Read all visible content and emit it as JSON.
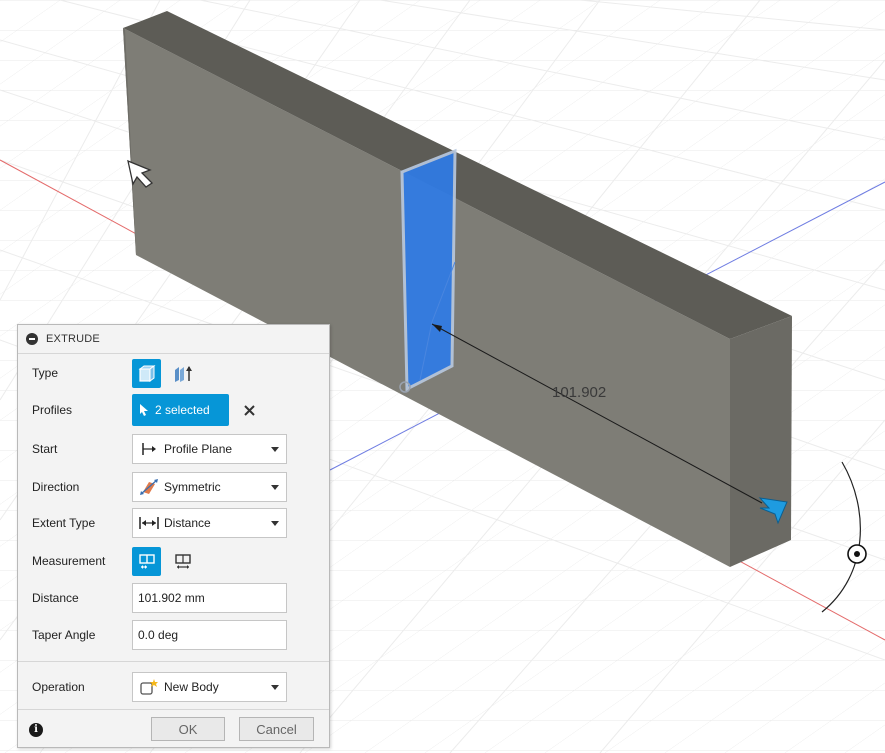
{
  "viewport": {
    "dimension_value": "101.902",
    "colors": {
      "body_front": "#7e7d76",
      "body_top": "#5d5c56",
      "body_side": "#6b6a64",
      "profile_face": "#2f7be6",
      "x_axis": "#e46b6b",
      "y_axis": "#6f7de2",
      "grid": "#e3e3e3",
      "handle": "#1e9be0"
    }
  },
  "dialog": {
    "title": "EXTRUDE",
    "type": {
      "label": "Type",
      "options": [
        {
          "name": "solid-extrude-icon",
          "selected": true
        },
        {
          "name": "thin-extrude-icon",
          "selected": false
        }
      ]
    },
    "profiles": {
      "label": "Profiles",
      "value": "2 selected"
    },
    "start": {
      "label": "Start",
      "value": "Profile Plane"
    },
    "direction": {
      "label": "Direction",
      "value": "Symmetric"
    },
    "extent_type": {
      "label": "Extent Type",
      "value": "Distance"
    },
    "measurement": {
      "label": "Measurement",
      "options": [
        {
          "name": "half-length-icon",
          "selected": true
        },
        {
          "name": "whole-length-icon",
          "selected": false
        }
      ]
    },
    "distance": {
      "label": "Distance",
      "value": "101.902 mm"
    },
    "taper_angle": {
      "label": "Taper Angle",
      "value": "0.0 deg"
    },
    "operation": {
      "label": "Operation",
      "value": "New Body"
    },
    "ok_label": "OK",
    "cancel_label": "Cancel"
  },
  "accent_color": "#0696d7"
}
